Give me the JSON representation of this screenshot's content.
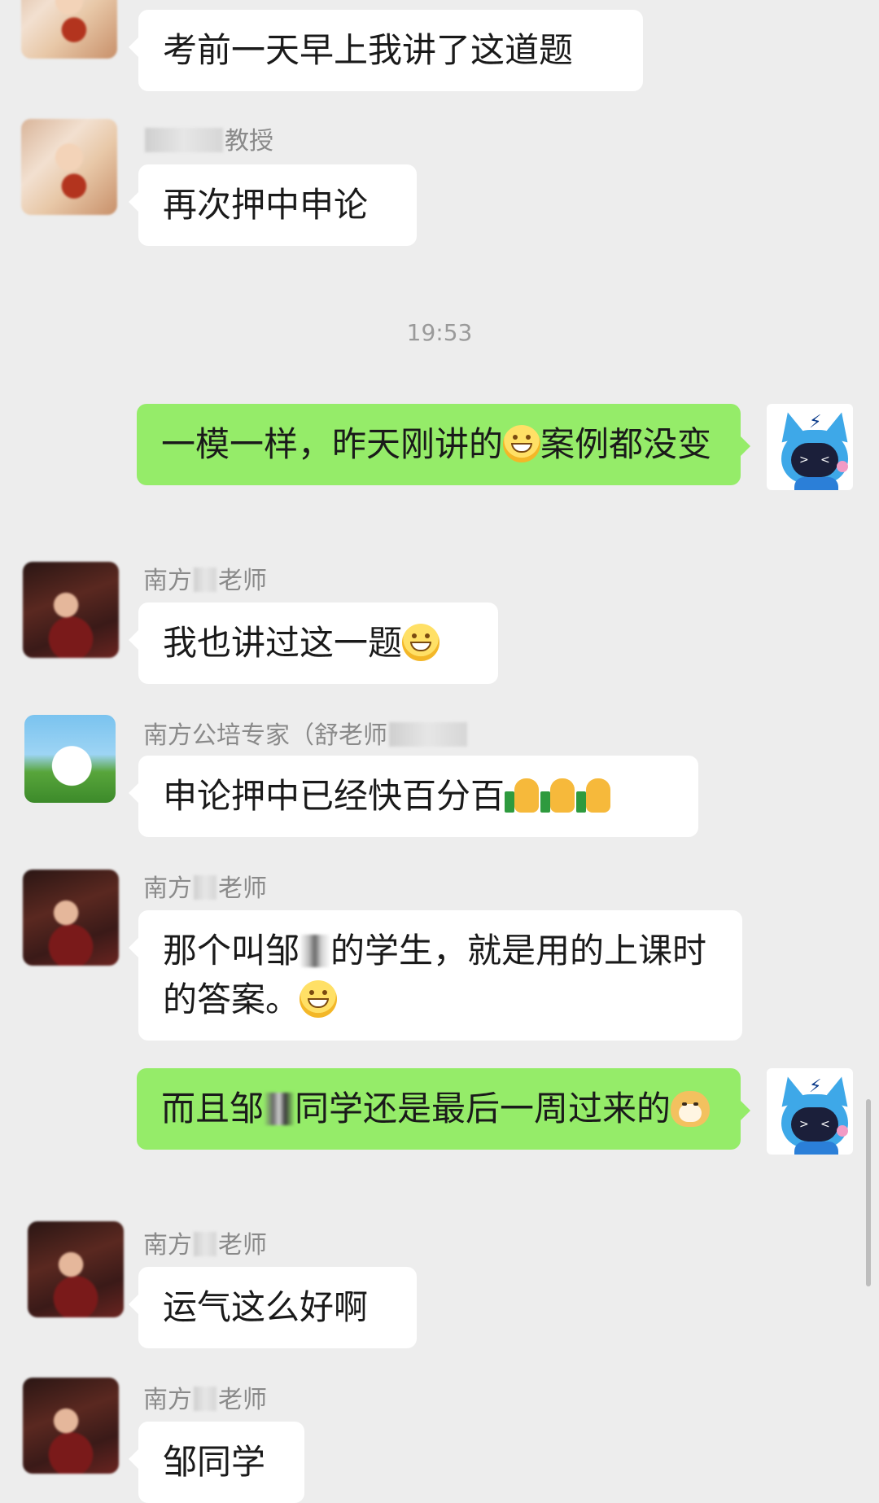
{
  "messages": [
    {
      "sender": "",
      "text": "考前一天早上我讲了这道题"
    },
    {
      "sender": "教授",
      "text": "再次押中申论"
    },
    {
      "timestamp": "19:53"
    },
    {
      "text_part1": "一模一样，昨天刚讲的",
      "emoji": "grinning-face",
      "text_part2": "案例都没变"
    },
    {
      "sender_prefix": "南方",
      "sender_suffix": "老师",
      "text": "我也讲过这一题",
      "emoji": "grinning-face"
    },
    {
      "sender": "南方公培专家（舒老师",
      "text": "申论押中已经快百分百",
      "emoji": "thumbs-up"
    },
    {
      "sender_prefix": "南方",
      "sender_suffix": "老师",
      "text_part1": "那个叫邹",
      "text_part2": "的学生，就是用的上课时的答案。",
      "emoji": "grinning-face"
    },
    {
      "text_part1": "而且邹",
      "text_part2": "同学还是最后一周过来的",
      "emoji": "doge"
    },
    {
      "sender_prefix": "南方",
      "sender_suffix": "老师",
      "text": "运气这么好啊"
    },
    {
      "sender_prefix": "南方",
      "sender_suffix": "老师",
      "text": "邹同学"
    }
  ],
  "colors": {
    "background": "#ededed",
    "incoming_bubble": "#ffffff",
    "outgoing_bubble": "#95ec69",
    "sender_name": "#8a8a8a",
    "timestamp": "#9a9a9a"
  }
}
